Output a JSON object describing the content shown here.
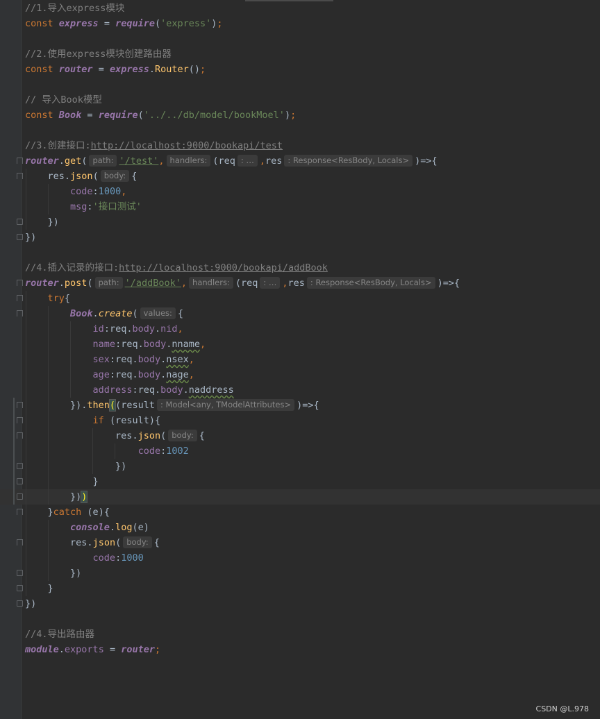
{
  "code": {
    "l1_comment": "//1.导入express模块",
    "l2_const": "const",
    "l2_var": "express",
    "l2_eq": " = ",
    "l2_fn": "require",
    "l2_arg": "'express'",
    "l4_comment": "//2.使用express模块创建路由器",
    "l5_var": "router",
    "l5_obj": "express",
    "l5_fn": "Router",
    "l7_comment": "// 导入Book模型",
    "l8_var": "Book",
    "l8_arg": "'../../db/model/bookMoel'",
    "l10_comment": "//3.创建接口:",
    "l10_url": "http://localhost:9000/bookapi/test",
    "l11_obj": "router",
    "l11_fn": "get",
    "l11_path": "'/test'",
    "l12_res": "res",
    "l12_json": "json",
    "l13_key": "code",
    "l13_val": "1000",
    "l14_key": "msg",
    "l14_val": "'接口测试'",
    "l17_comment": "//4.插入记录的接口:",
    "l17_url": "http://localhost:9000/bookapi/addBook",
    "l18_fn": "post",
    "l18_path": "'/addBook'",
    "l19_try": "try",
    "l20_create": "create",
    "l21_key": "id",
    "l21_val": "nid",
    "l22_key": "name",
    "l22_val": "nname",
    "l23_key": "sex",
    "l23_val": "nsex",
    "l24_key": "age",
    "l24_val": "nage",
    "l25_key": "address",
    "l25_val": "naddress",
    "l26_then": "then",
    "l26_param": "result",
    "l27_if": "if",
    "l29_val": "1002",
    "l33_catch": "catch",
    "l33_param": "e",
    "l34_console": "console",
    "l34_log": "log",
    "l36_val": "1000",
    "l41_comment": "//4.导出路由器",
    "l42_module": "module",
    "l42_exports": "exports"
  },
  "hints": {
    "path": "path:",
    "handlers": "handlers:",
    "req_type": ": …",
    "res_type": ": Response<ResBody, Locals>",
    "body": "body:",
    "values": "values:",
    "model_type": ": Model<any, TModelAttributes>"
  },
  "watermark": "CSDN @L.978"
}
